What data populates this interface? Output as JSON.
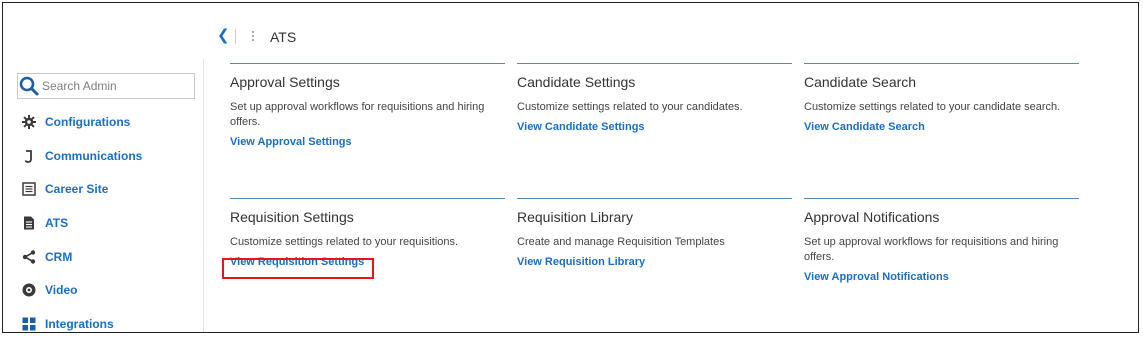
{
  "header": {
    "back_icon": "chevron-left-icon",
    "menu_icon": "kebab-icon",
    "breadcrumb": "ATS"
  },
  "sidebar": {
    "search": {
      "placeholder": "Search Admin",
      "value": "",
      "icon": "search-icon"
    },
    "items": [
      {
        "label": "Configurations",
        "icon": "gear-icon"
      },
      {
        "label": "Communications",
        "icon": "communications-icon"
      },
      {
        "label": "Career Site",
        "icon": "document-list-icon"
      },
      {
        "label": "ATS",
        "icon": "document-icon"
      },
      {
        "label": "CRM",
        "icon": "share-icon"
      },
      {
        "label": "Video",
        "icon": "video-icon"
      },
      {
        "label": "Integrations",
        "icon": "grid-icon"
      }
    ]
  },
  "cards": [
    {
      "title": "Approval Settings",
      "description": "Set up approval workflows for requisitions and hiring offers.",
      "link": "View Approval Settings"
    },
    {
      "title": "Candidate Settings",
      "description": "Customize settings related to your candidates.",
      "link": "View Candidate Settings"
    },
    {
      "title": "Candidate Search",
      "description": "Customize settings related to your candidate search.",
      "link": "View Candidate Search"
    },
    {
      "title": "Requisition Settings",
      "description": "Customize settings related to your requisitions.",
      "link": "View Requisition Settings"
    },
    {
      "title": "Requisition Library",
      "description": "Create and manage Requisition Templates",
      "link": "View Requisition Library"
    },
    {
      "title": "Approval Notifications",
      "description": "Set up approval workflows for requisitions and hiring offers.",
      "link": "View Approval Notifications"
    }
  ],
  "colors": {
    "accent": "#1b6ec2",
    "rule": "#5a88b5",
    "highlight": "#e8141b"
  }
}
